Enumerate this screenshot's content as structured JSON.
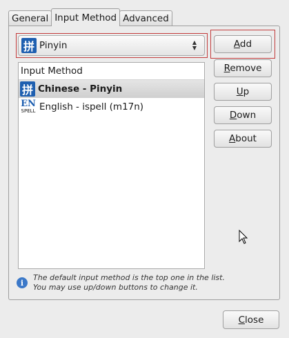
{
  "tabs": [
    {
      "label": "General"
    },
    {
      "label": "Input Method"
    },
    {
      "label": "Advanced"
    }
  ],
  "combo": {
    "selected": "Pinyin",
    "icon": "pinyin-ime-icon"
  },
  "list": {
    "header": "Input Method",
    "rows": [
      {
        "label": "Chinese - Pinyin",
        "icon": "pinyin-ime-icon",
        "selected": true
      },
      {
        "label": "English - ispell (m17n)",
        "icon": "en-spell-icon",
        "selected": false
      }
    ]
  },
  "icons": {
    "pinyin_glyph": "拼",
    "en_top": "EN",
    "en_bottom": "SPELL",
    "info_glyph": "i"
  },
  "buttons": {
    "add_pre": "",
    "add_mn": "A",
    "add_post": "dd",
    "remove_pre": "",
    "remove_mn": "R",
    "remove_post": "emove",
    "up_pre": "",
    "up_mn": "U",
    "up_post": "p",
    "down_pre": "",
    "down_mn": "D",
    "down_post": "own",
    "about_pre": "",
    "about_mn": "A",
    "about_post": "bout",
    "close_pre": "",
    "close_mn": "C",
    "close_post": "lose"
  },
  "info": {
    "line1": "The default input method is the top one in the list.",
    "line2": "You may use up/down buttons to change it."
  },
  "colors": {
    "accent": "#1e5fb0",
    "focus": "#c23a3a"
  }
}
